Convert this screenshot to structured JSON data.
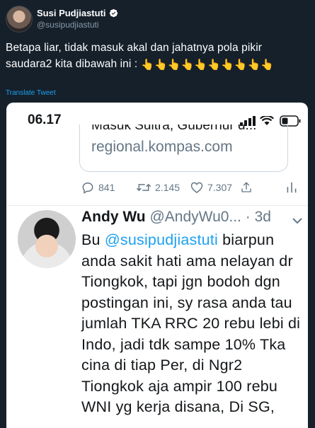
{
  "header": {
    "name": "Susi Pudjiastuti",
    "handle": "@susipudjiastuti"
  },
  "tweet": {
    "text": "Betapa liar, tidak masuk akal dan jahatnya pola pikir saudara2 kita dibawah ini :",
    "emoji": "👇👇👇👇👇👇👇👇👇👇",
    "translate_label": "Translate Tweet"
  },
  "screenshot": {
    "status_time": "06.17",
    "card": {
      "title_partial": "Masuk Sultra, Gubernur d...",
      "domain": "regional.kompas.com"
    },
    "actions": {
      "replies": "841",
      "retweets": "2.145",
      "likes": "7.307"
    },
    "reply": {
      "name": "Andy Wu",
      "handle": "@AndyWu0...",
      "time": "· 3d",
      "prefix": "Bu ",
      "mention": "@susipudjiastuti",
      "body": "  biarpun anda sakit hati ama nelayan dr Tiongkok, tapi jgn bodoh dgn postingan ini, sy rasa anda tau jumlah TKA RRC 20 rebu lebi di Indo, jadi tdk sampe 10% Tka cina di tiap Per, di Ngr2 Tiongkok aja ampir 100 rebu WNI yg kerja disana, Di SG,"
    }
  },
  "colors": {
    "background": "#15202b",
    "accent": "#1da1f2",
    "muted": "#8899a6"
  }
}
